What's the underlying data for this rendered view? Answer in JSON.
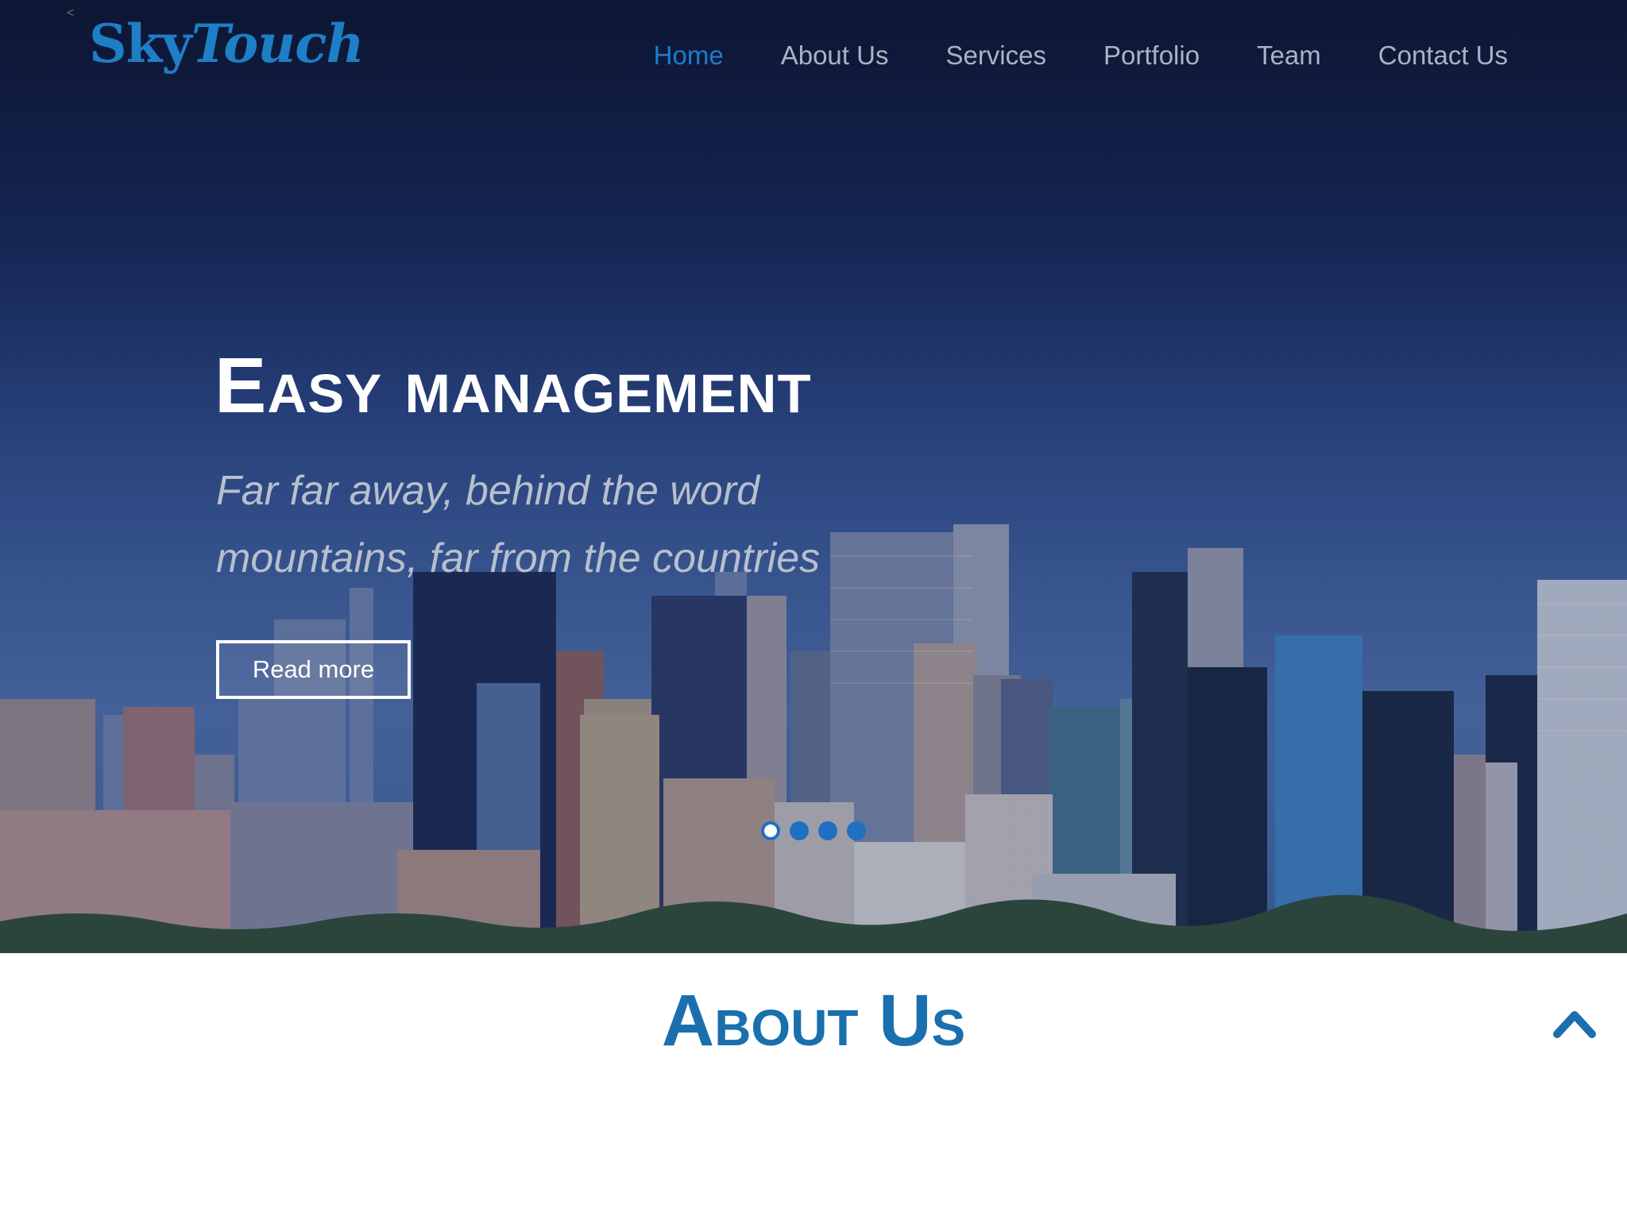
{
  "header": {
    "back_glyph": "<",
    "logo_sky": "Sky",
    "logo_touch": "Touch",
    "nav": [
      {
        "label": "Home",
        "active": true
      },
      {
        "label": "About Us",
        "active": false
      },
      {
        "label": "Services",
        "active": false
      },
      {
        "label": "Portfolio",
        "active": false
      },
      {
        "label": "Team",
        "active": false
      },
      {
        "label": "Contact Us",
        "active": false
      }
    ]
  },
  "hero": {
    "title": "Easy management",
    "subtitle": "Far far away, behind the word mountains, far from the countries",
    "button_label": "Read more",
    "slide_count": 4,
    "active_slide": 1
  },
  "about": {
    "title": "About Us"
  },
  "colors": {
    "accent": "#1c7ccd",
    "nav_text": "#a9b3c3",
    "about_title": "#1a6fae",
    "hero_dark": "#0e1836"
  },
  "icons": {
    "scroll_top": "chevron-up-icon"
  }
}
